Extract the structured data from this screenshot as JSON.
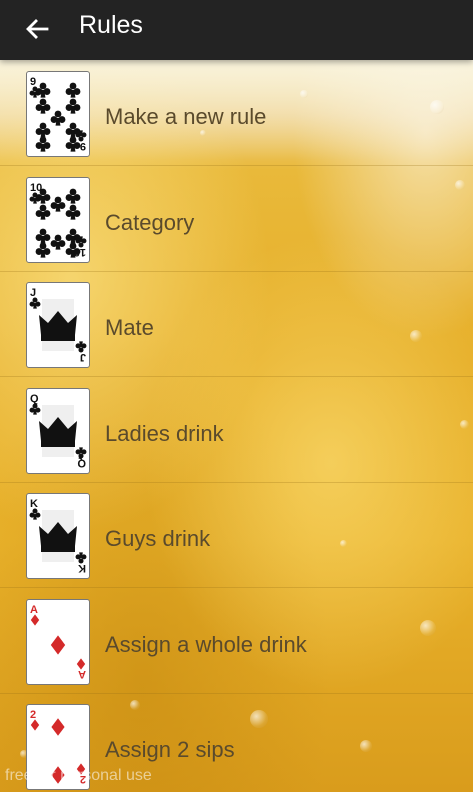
{
  "app_bar": {
    "title": "Rules",
    "back_icon": "arrow-left-icon"
  },
  "colors": {
    "app_bar_bg": "#232323",
    "label_text": "#5a4a2c",
    "black_suit": "#111111",
    "red_suit": "#d42a2a"
  },
  "rules": [
    {
      "rank": "9",
      "suit": "clubs",
      "label": "Make a new rule"
    },
    {
      "rank": "10",
      "suit": "clubs",
      "label": "Category"
    },
    {
      "rank": "J",
      "suit": "clubs",
      "label": "Mate"
    },
    {
      "rank": "Q",
      "suit": "clubs",
      "label": "Ladies drink"
    },
    {
      "rank": "K",
      "suit": "clubs",
      "label": "Guys drink"
    },
    {
      "rank": "A",
      "suit": "diamonds",
      "label": "Assign a whole drink"
    },
    {
      "rank": "2",
      "suit": "diamonds",
      "label": "Assign 2 sips"
    }
  ],
  "watermark": "free for personal use"
}
